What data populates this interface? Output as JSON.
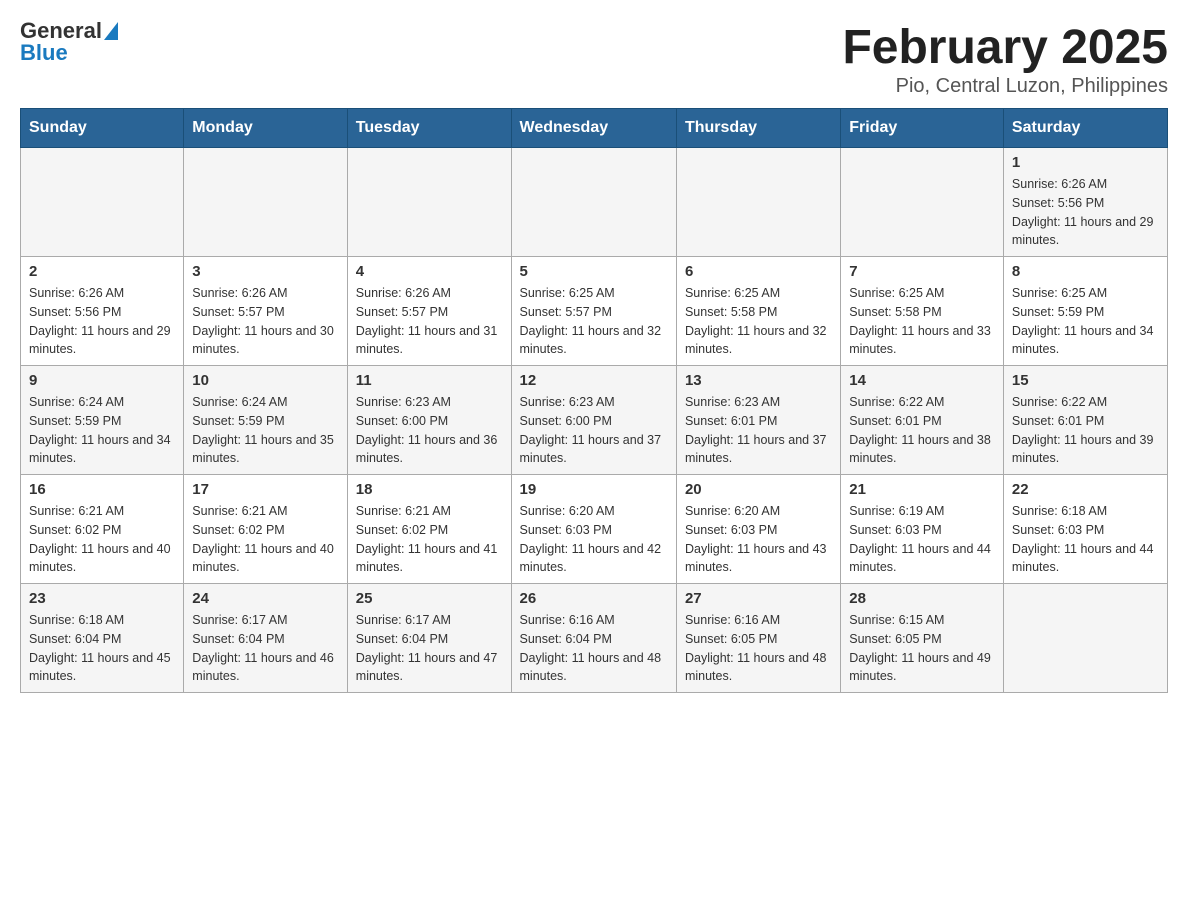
{
  "header": {
    "logo_text_general": "General",
    "logo_text_blue": "Blue",
    "title": "February 2025",
    "subtitle": "Pio, Central Luzon, Philippines"
  },
  "weekdays": [
    "Sunday",
    "Monday",
    "Tuesday",
    "Wednesday",
    "Thursday",
    "Friday",
    "Saturday"
  ],
  "weeks": [
    [
      {
        "day": "",
        "sunrise": "",
        "sunset": "",
        "daylight": ""
      },
      {
        "day": "",
        "sunrise": "",
        "sunset": "",
        "daylight": ""
      },
      {
        "day": "",
        "sunrise": "",
        "sunset": "",
        "daylight": ""
      },
      {
        "day": "",
        "sunrise": "",
        "sunset": "",
        "daylight": ""
      },
      {
        "day": "",
        "sunrise": "",
        "sunset": "",
        "daylight": ""
      },
      {
        "day": "",
        "sunrise": "",
        "sunset": "",
        "daylight": ""
      },
      {
        "day": "1",
        "sunrise": "Sunrise: 6:26 AM",
        "sunset": "Sunset: 5:56 PM",
        "daylight": "Daylight: 11 hours and 29 minutes."
      }
    ],
    [
      {
        "day": "2",
        "sunrise": "Sunrise: 6:26 AM",
        "sunset": "Sunset: 5:56 PM",
        "daylight": "Daylight: 11 hours and 29 minutes."
      },
      {
        "day": "3",
        "sunrise": "Sunrise: 6:26 AM",
        "sunset": "Sunset: 5:57 PM",
        "daylight": "Daylight: 11 hours and 30 minutes."
      },
      {
        "day": "4",
        "sunrise": "Sunrise: 6:26 AM",
        "sunset": "Sunset: 5:57 PM",
        "daylight": "Daylight: 11 hours and 31 minutes."
      },
      {
        "day": "5",
        "sunrise": "Sunrise: 6:25 AM",
        "sunset": "Sunset: 5:57 PM",
        "daylight": "Daylight: 11 hours and 32 minutes."
      },
      {
        "day": "6",
        "sunrise": "Sunrise: 6:25 AM",
        "sunset": "Sunset: 5:58 PM",
        "daylight": "Daylight: 11 hours and 32 minutes."
      },
      {
        "day": "7",
        "sunrise": "Sunrise: 6:25 AM",
        "sunset": "Sunset: 5:58 PM",
        "daylight": "Daylight: 11 hours and 33 minutes."
      },
      {
        "day": "8",
        "sunrise": "Sunrise: 6:25 AM",
        "sunset": "Sunset: 5:59 PM",
        "daylight": "Daylight: 11 hours and 34 minutes."
      }
    ],
    [
      {
        "day": "9",
        "sunrise": "Sunrise: 6:24 AM",
        "sunset": "Sunset: 5:59 PM",
        "daylight": "Daylight: 11 hours and 34 minutes."
      },
      {
        "day": "10",
        "sunrise": "Sunrise: 6:24 AM",
        "sunset": "Sunset: 5:59 PM",
        "daylight": "Daylight: 11 hours and 35 minutes."
      },
      {
        "day": "11",
        "sunrise": "Sunrise: 6:23 AM",
        "sunset": "Sunset: 6:00 PM",
        "daylight": "Daylight: 11 hours and 36 minutes."
      },
      {
        "day": "12",
        "sunrise": "Sunrise: 6:23 AM",
        "sunset": "Sunset: 6:00 PM",
        "daylight": "Daylight: 11 hours and 37 minutes."
      },
      {
        "day": "13",
        "sunrise": "Sunrise: 6:23 AM",
        "sunset": "Sunset: 6:01 PM",
        "daylight": "Daylight: 11 hours and 37 minutes."
      },
      {
        "day": "14",
        "sunrise": "Sunrise: 6:22 AM",
        "sunset": "Sunset: 6:01 PM",
        "daylight": "Daylight: 11 hours and 38 minutes."
      },
      {
        "day": "15",
        "sunrise": "Sunrise: 6:22 AM",
        "sunset": "Sunset: 6:01 PM",
        "daylight": "Daylight: 11 hours and 39 minutes."
      }
    ],
    [
      {
        "day": "16",
        "sunrise": "Sunrise: 6:21 AM",
        "sunset": "Sunset: 6:02 PM",
        "daylight": "Daylight: 11 hours and 40 minutes."
      },
      {
        "day": "17",
        "sunrise": "Sunrise: 6:21 AM",
        "sunset": "Sunset: 6:02 PM",
        "daylight": "Daylight: 11 hours and 40 minutes."
      },
      {
        "day": "18",
        "sunrise": "Sunrise: 6:21 AM",
        "sunset": "Sunset: 6:02 PM",
        "daylight": "Daylight: 11 hours and 41 minutes."
      },
      {
        "day": "19",
        "sunrise": "Sunrise: 6:20 AM",
        "sunset": "Sunset: 6:03 PM",
        "daylight": "Daylight: 11 hours and 42 minutes."
      },
      {
        "day": "20",
        "sunrise": "Sunrise: 6:20 AM",
        "sunset": "Sunset: 6:03 PM",
        "daylight": "Daylight: 11 hours and 43 minutes."
      },
      {
        "day": "21",
        "sunrise": "Sunrise: 6:19 AM",
        "sunset": "Sunset: 6:03 PM",
        "daylight": "Daylight: 11 hours and 44 minutes."
      },
      {
        "day": "22",
        "sunrise": "Sunrise: 6:18 AM",
        "sunset": "Sunset: 6:03 PM",
        "daylight": "Daylight: 11 hours and 44 minutes."
      }
    ],
    [
      {
        "day": "23",
        "sunrise": "Sunrise: 6:18 AM",
        "sunset": "Sunset: 6:04 PM",
        "daylight": "Daylight: 11 hours and 45 minutes."
      },
      {
        "day": "24",
        "sunrise": "Sunrise: 6:17 AM",
        "sunset": "Sunset: 6:04 PM",
        "daylight": "Daylight: 11 hours and 46 minutes."
      },
      {
        "day": "25",
        "sunrise": "Sunrise: 6:17 AM",
        "sunset": "Sunset: 6:04 PM",
        "daylight": "Daylight: 11 hours and 47 minutes."
      },
      {
        "day": "26",
        "sunrise": "Sunrise: 6:16 AM",
        "sunset": "Sunset: 6:04 PM",
        "daylight": "Daylight: 11 hours and 48 minutes."
      },
      {
        "day": "27",
        "sunrise": "Sunrise: 6:16 AM",
        "sunset": "Sunset: 6:05 PM",
        "daylight": "Daylight: 11 hours and 48 minutes."
      },
      {
        "day": "28",
        "sunrise": "Sunrise: 6:15 AM",
        "sunset": "Sunset: 6:05 PM",
        "daylight": "Daylight: 11 hours and 49 minutes."
      },
      {
        "day": "",
        "sunrise": "",
        "sunset": "",
        "daylight": ""
      }
    ]
  ]
}
